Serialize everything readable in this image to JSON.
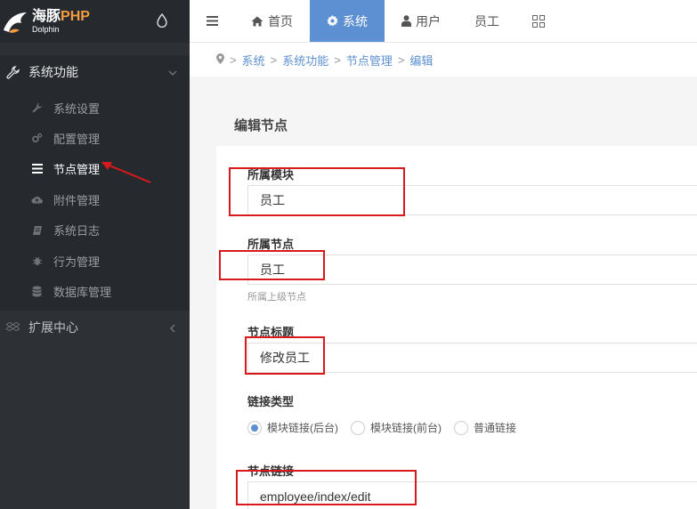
{
  "app": {
    "logo_title": "海豚",
    "logo_php": "PHP",
    "logo_sub": "Dolphin"
  },
  "sidebar": {
    "groups": [
      {
        "label": "系统功能",
        "icon": "wrench-icon",
        "expanded": true
      },
      {
        "label": "扩展中心",
        "icon": "dropbox-icon",
        "expanded": false
      }
    ],
    "items": [
      {
        "label": "系统设置",
        "icon": "wrench-icon"
      },
      {
        "label": "配置管理",
        "icon": "cogs-icon"
      },
      {
        "label": "节点管理",
        "icon": "bars-icon",
        "current": true
      },
      {
        "label": "附件管理",
        "icon": "cloud-upload-icon"
      },
      {
        "label": "系统日志",
        "icon": "book-icon"
      },
      {
        "label": "行为管理",
        "icon": "bug-icon"
      },
      {
        "label": "数据库管理",
        "icon": "database-icon"
      }
    ]
  },
  "topbar": {
    "tabs": [
      {
        "label": "首页",
        "icon": "home-icon"
      },
      {
        "label": "系统",
        "icon": "cog-icon",
        "active": true
      },
      {
        "label": "用户",
        "icon": "user-icon"
      },
      {
        "label": "员工"
      }
    ]
  },
  "breadcrumb": {
    "items": [
      "系统",
      "系统功能",
      "节点管理",
      "编辑"
    ]
  },
  "form": {
    "title": "编辑节点",
    "module_label": "所属模块",
    "module_value": "员工",
    "parent_label": "所属节点",
    "parent_value": "员工",
    "parent_help": "所属上级节点",
    "title_label": "节点标题",
    "title_value": "修改员工",
    "link_type_label": "链接类型",
    "link_type_options": [
      "模块链接(后台)",
      "模块链接(前台)",
      "普通链接"
    ],
    "link_type_selected": "模块链接(后台)",
    "url_label": "节点链接",
    "url_value": "employee/index/edit"
  },
  "colors": {
    "sidebar_bg": "#2d3035",
    "accent": "#5c90d2",
    "logo_php": "#f39c40",
    "annotation_red": "#d9191c"
  }
}
